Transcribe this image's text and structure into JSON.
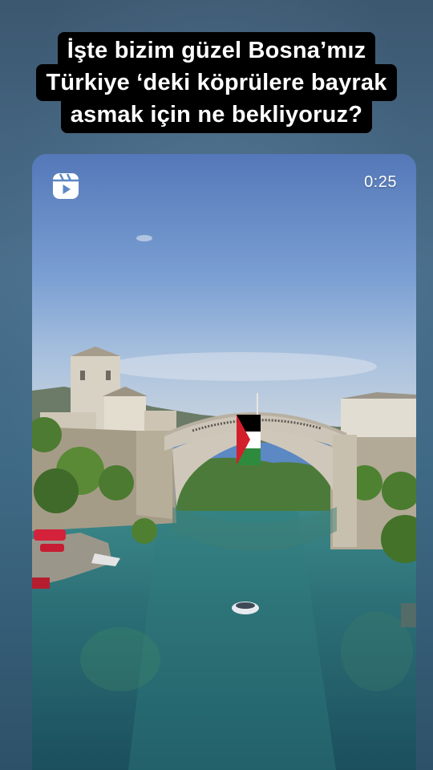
{
  "caption": {
    "lines": [
      "İşte bizim güzel Bosna’mız",
      "Türkiye ‘deki köprülere bayrak",
      "asmak için ne bekliyoruz?"
    ]
  },
  "video": {
    "duration": "0:25",
    "icon": "reels-icon"
  },
  "colors": {
    "caption_bg": "#000000",
    "caption_text": "#ffffff",
    "story_bg": "#4a6f8c"
  }
}
